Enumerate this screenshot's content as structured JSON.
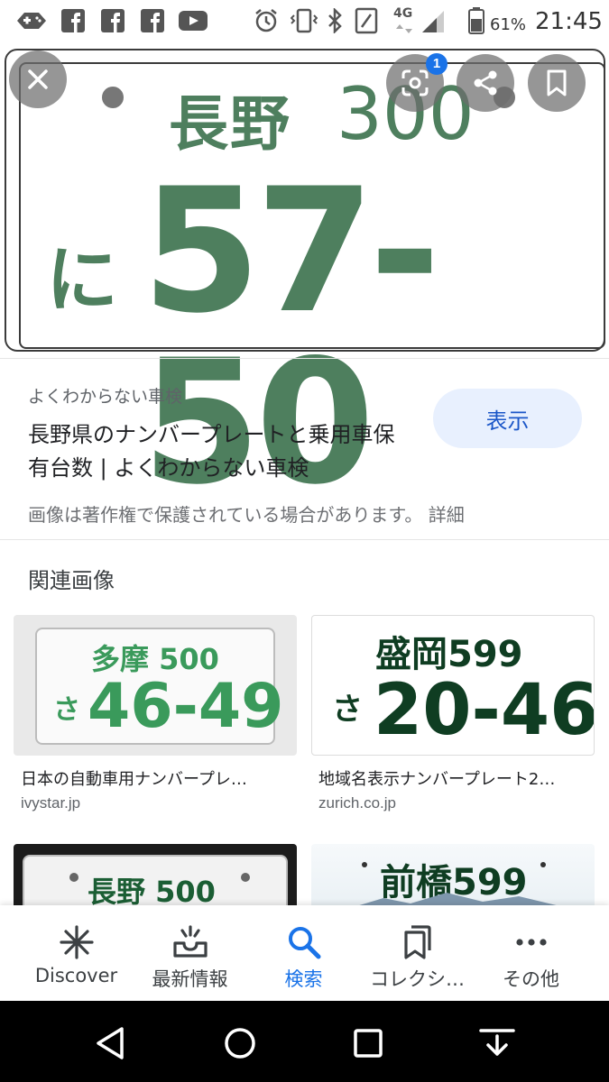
{
  "status_bar": {
    "battery_percent": "61%",
    "time": "21:45",
    "network": "4G",
    "left_icons": [
      "game-controller-icon",
      "facebook-icon",
      "facebook-icon",
      "facebook-icon",
      "youtube-icon"
    ],
    "right_icons": [
      "alarm-icon",
      "vibrate-icon",
      "bluetooth-icon",
      "nfc-icon",
      "signal-icon",
      "battery-icon"
    ]
  },
  "hero": {
    "plate_region": "長野",
    "plate_class": "300",
    "plate_kana": "に",
    "plate_number": "57-50",
    "lens_badge_count": "1",
    "plate_color": "#4e7f5e"
  },
  "result": {
    "source": "よくわからない車検",
    "title": "長野県のナンバープレートと乗用車保有台数 | よくわからない車検",
    "view_button": "表示",
    "copyright_note": "画像は著作権で保護されている場合があります。 詳細"
  },
  "related": {
    "heading": "関連画像",
    "cards": [
      {
        "plate_top": "多摩 500",
        "plate_kana": "さ",
        "plate_number": "46-49",
        "title": "日本の自動車用ナンバープレ…",
        "host": "ivystar.jp",
        "color": "#3a9a5b"
      },
      {
        "plate_top": "盛岡599",
        "plate_kana": "さ",
        "plate_number": "20-46",
        "title": "地域名表示ナンバープレート2…",
        "host": "zurich.co.jp",
        "color": "#0f3d22"
      },
      {
        "plate_top": "長野 500",
        "title": "",
        "host": "",
        "color": "#1b5e34"
      },
      {
        "plate_top": "前橋599",
        "title": "",
        "host": "",
        "color": "#0f3d22"
      }
    ]
  },
  "bottom_nav": {
    "items": [
      {
        "label": "Discover",
        "icon": "asterisk-icon",
        "active": false
      },
      {
        "label": "最新情報",
        "icon": "inbox-update-icon",
        "active": false
      },
      {
        "label": "検索",
        "icon": "search-icon",
        "active": true
      },
      {
        "label": "コレクシ…",
        "icon": "collections-icon",
        "active": false
      },
      {
        "label": "その他",
        "icon": "more-dots-icon",
        "active": false
      }
    ],
    "active_color": "#1a73e8"
  },
  "system_nav": {
    "buttons": [
      "back-icon",
      "home-icon",
      "recents-icon",
      "keyboard-hide-icon"
    ]
  }
}
